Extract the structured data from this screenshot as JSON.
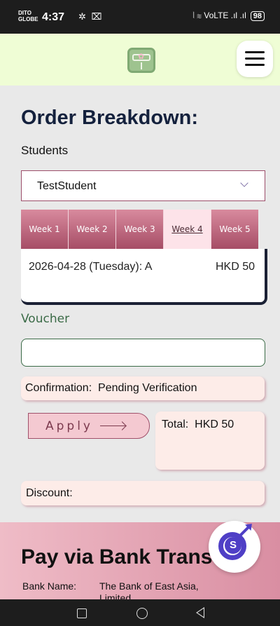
{
  "status_bar": {
    "carrier_line1": "DITO",
    "carrier_line2": "GLOBE",
    "time": "4:37",
    "notification_icons": "✲ ⌧",
    "network_icons": "⦚ ≋ VoLTE .ıl .ıl",
    "battery": "98"
  },
  "header": {
    "logo_icon": "lunchbox-logo-icon",
    "menu_icon": "hamburger-menu-icon"
  },
  "main": {
    "title": "Order Breakdown:",
    "students_label": "Students",
    "selected_student": "TestStudent",
    "week_tabs": [
      {
        "label": "Week 1"
      },
      {
        "label": "Week 2"
      },
      {
        "label": "Week 3"
      },
      {
        "label": "Week 4"
      },
      {
        "label": "Week 5"
      }
    ],
    "active_week": "Week 4",
    "orders": [
      {
        "line": "2026-04-28 (Tuesday): A",
        "amount": "HKD 50"
      }
    ],
    "voucher_label": "Voucher",
    "voucher_value": "",
    "confirmation_text": "Confirmation:  Pending Verification",
    "apply_label": "Apply",
    "total_text": "Total:  HKD 50",
    "discount_text": "Discount:"
  },
  "bank": {
    "title": "Pay via Bank Trans",
    "bank_name_key": "Bank Name:",
    "bank_name_value": "The Bank of East Asia,",
    "bank_name_value_line2": "Limited"
  },
  "colors": {
    "header_bg": "#effdd5",
    "accent_pink": "#a64d66",
    "voucher_green": "#3b6b47",
    "fab_purple": "#4f3fc6"
  }
}
